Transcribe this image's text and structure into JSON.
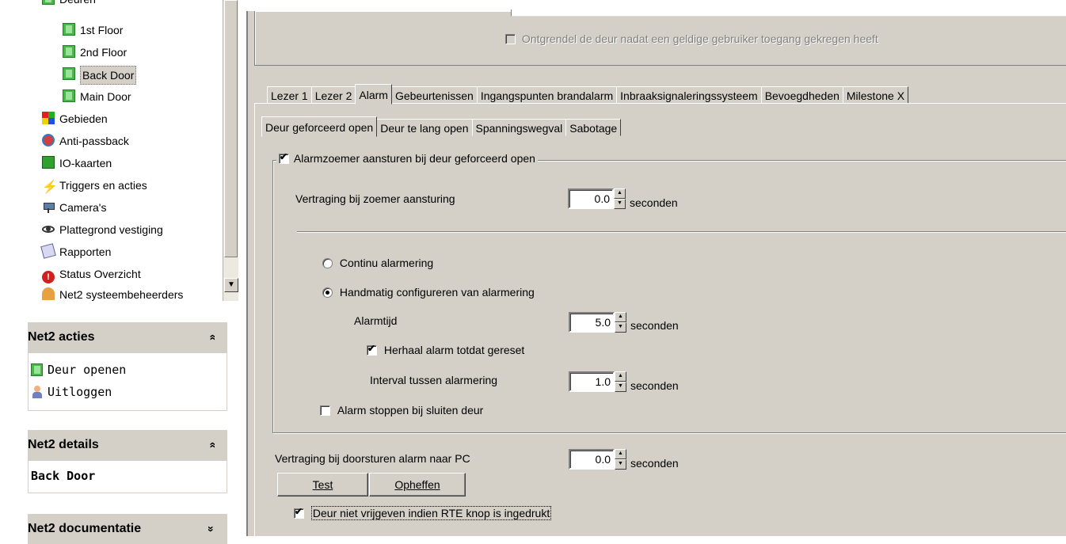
{
  "tree": {
    "items": [
      {
        "label": "Deuren",
        "icon": "door-group-icon"
      },
      {
        "label": "1st Floor",
        "icon": "door-icon"
      },
      {
        "label": "2nd Floor",
        "icon": "door-icon"
      },
      {
        "label": "Back Door",
        "icon": "door-icon",
        "selected": true
      },
      {
        "label": "Main Door",
        "icon": "door-icon"
      },
      {
        "label": "Gebieden",
        "icon": "areas-icon"
      },
      {
        "label": "Anti-passback",
        "icon": "anti-passback-icon"
      },
      {
        "label": "IO-kaarten",
        "icon": "io-card-icon"
      },
      {
        "label": "Triggers en acties",
        "icon": "lightning-icon"
      },
      {
        "label": "Camera's",
        "icon": "camera-icon"
      },
      {
        "label": "Plattegrond vestiging",
        "icon": "eye-icon"
      },
      {
        "label": "Rapporten",
        "icon": "report-icon"
      },
      {
        "label": "Status Overzicht",
        "icon": "alert-icon"
      },
      {
        "label": "Net2 systeembeheerders",
        "icon": "operators-icon"
      }
    ]
  },
  "panels": {
    "acties": {
      "title": "Net2 acties",
      "chevron": "»",
      "items": [
        {
          "label": "Deur openen",
          "icon": "door-icon"
        },
        {
          "label": "Uitloggen",
          "icon": "user-icon"
        }
      ]
    },
    "details": {
      "title": "Net2 details",
      "chevron": "»",
      "value": "Back Door"
    },
    "documentatie": {
      "title": "Net2 documentatie",
      "chevron": "»"
    }
  },
  "top": {
    "unlock_checkbox_label": "Ontgrendel de deur nadat een geldige gebruiker toegang gekregen heeft"
  },
  "tabs": [
    "Lezer 1",
    "Lezer 2",
    "Alarm",
    "Gebeurtenissen",
    "Ingangspunten brandalarm",
    "Inbraaksignaleringssysteem",
    "Bevoegdheden",
    "Milestone X"
  ],
  "active_tab": "Alarm",
  "subtabs": [
    "Deur geforceerd open",
    "Deur te lang open",
    "Spanningswegval",
    "Sabotage"
  ],
  "active_subtab": "Deur geforceerd open",
  "alarm": {
    "group_label": "Alarmzoemer aansturen bij deur geforceerd open",
    "group_checked": true,
    "delay_label": "Vertraging bij zoemer aansturing",
    "delay_value": "0.0",
    "seconds": "seconden",
    "continuous_label": "Continu alarmering",
    "manual_label": "Handmatig configureren van alarmering",
    "alarm_time_label": "Alarmtijd",
    "alarm_time_value": "5.0",
    "repeat_label": "Herhaal alarm totdat gereset",
    "repeat_checked": true,
    "interval_label": "Interval tussen alarmering",
    "interval_value": "1.0",
    "stop_label": "Alarm stoppen bij sluiten deur",
    "stop_checked": false
  },
  "pc": {
    "delay_label": "Vertraging bij doorsturen alarm naar PC",
    "delay_value": "0.0",
    "seconds": "seconden",
    "test_label": "Test",
    "cancel_label": "Opheffen",
    "rte_label": "Deur niet vrijgeven indien RTE knop is ingedrukt",
    "rte_checked": true
  }
}
